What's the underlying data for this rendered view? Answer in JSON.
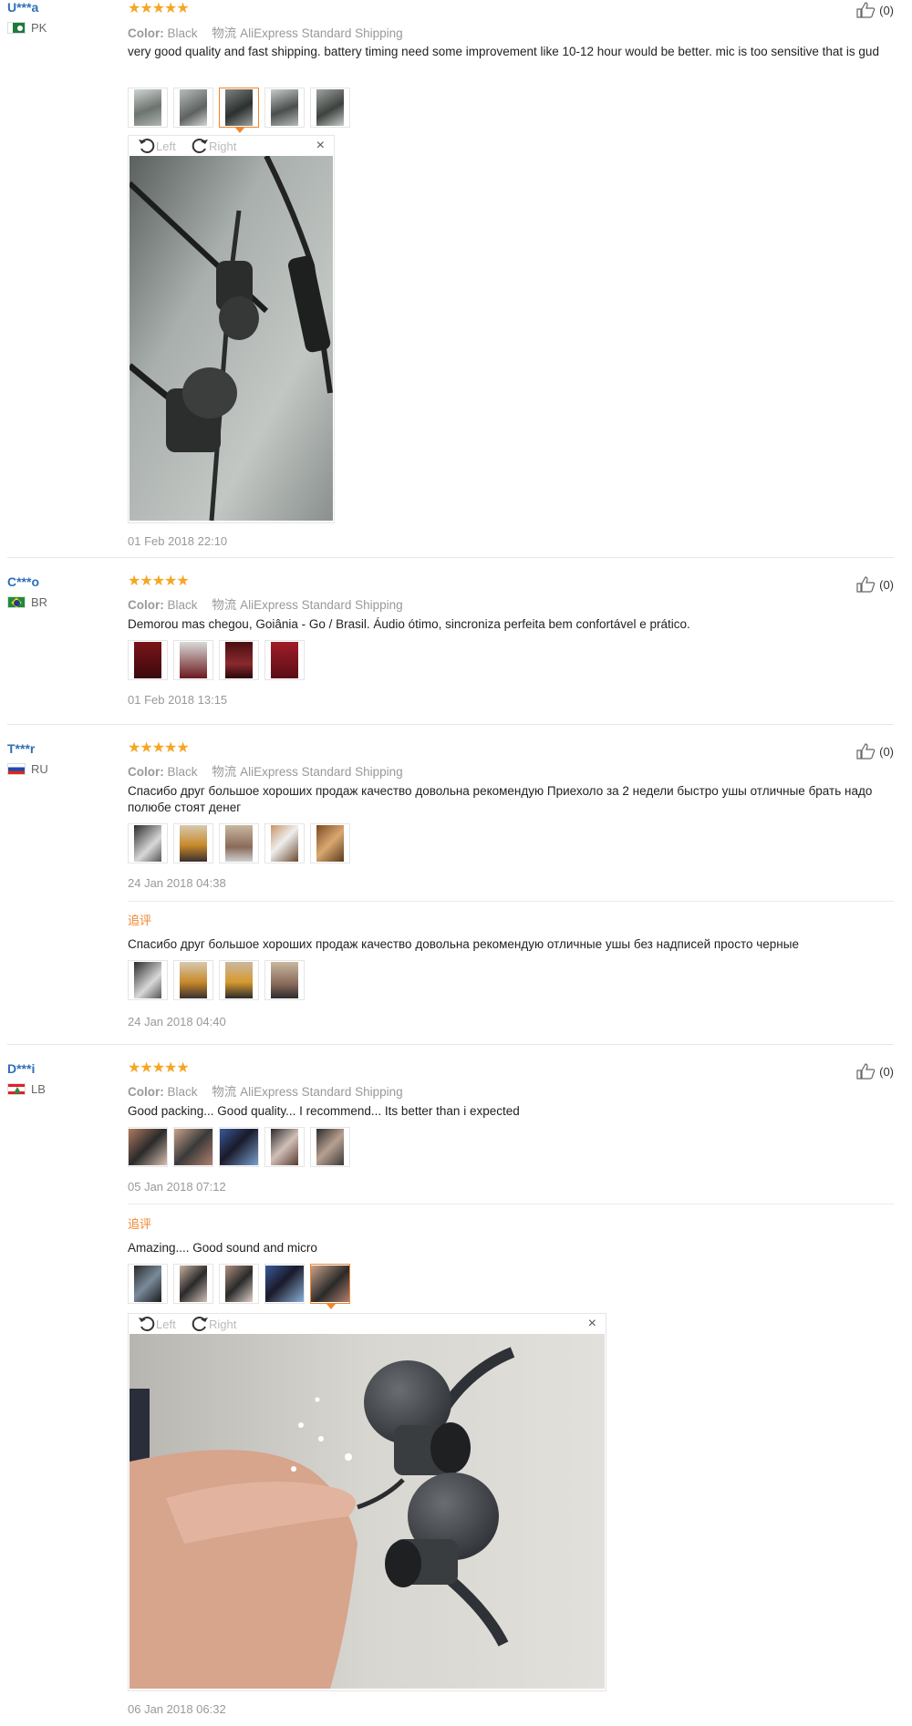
{
  "common": {
    "color_label": "Color:",
    "color_value": "Black",
    "ship_cn": "物流",
    "ship_name": "AliExpress Standard Shipping",
    "stars": "★★★★★",
    "rotate_left": "Left",
    "rotate_right": "Right",
    "close": "×",
    "append_label": "追评"
  },
  "reviews": [
    {
      "user": "U***a",
      "country": "PK",
      "likes": "(0)",
      "text": "very good quality and fast shipping. battery timing need some improvement like 10-12 hour would be better. mic is too sensitive that is gud",
      "date": "01 Feb 2018 22:10"
    },
    {
      "user": "C***o",
      "country": "BR",
      "likes": "(0)",
      "text": "Demorou mas chegou, Goiânia - Go / Brasil. Áudio ótimo, sincroniza perfeita bem confortável e prático.",
      "date": "01 Feb 2018 13:15"
    },
    {
      "user": "T***r",
      "country": "RU",
      "likes": "(0)",
      "text": "Спасибо друг большое хороших продаж качество довольна рекомендую Приехоло за 2 недели быстро ушы отличные брать надо полюбе стоят денег",
      "date": "24 Jan 2018 04:38",
      "append_text": "Спасибо друг большое хороших продаж качество довольна рекомендую отличные ушы без надписей просто черные",
      "append_date": "24 Jan 2018 04:40"
    },
    {
      "user": "D***i",
      "country": "LB",
      "likes": "(0)",
      "text": "Good packing... Good quality... I recommend... Its better than i expected",
      "date": "05 Jan 2018 07:12",
      "append_text": "Amazing.... Good sound and micro",
      "append_date": "06 Jan 2018 06:32"
    }
  ],
  "colors": {
    "username": "#2f6fb7",
    "star": "#f5a623",
    "accent": "#f0862c",
    "muted": "#999999"
  }
}
